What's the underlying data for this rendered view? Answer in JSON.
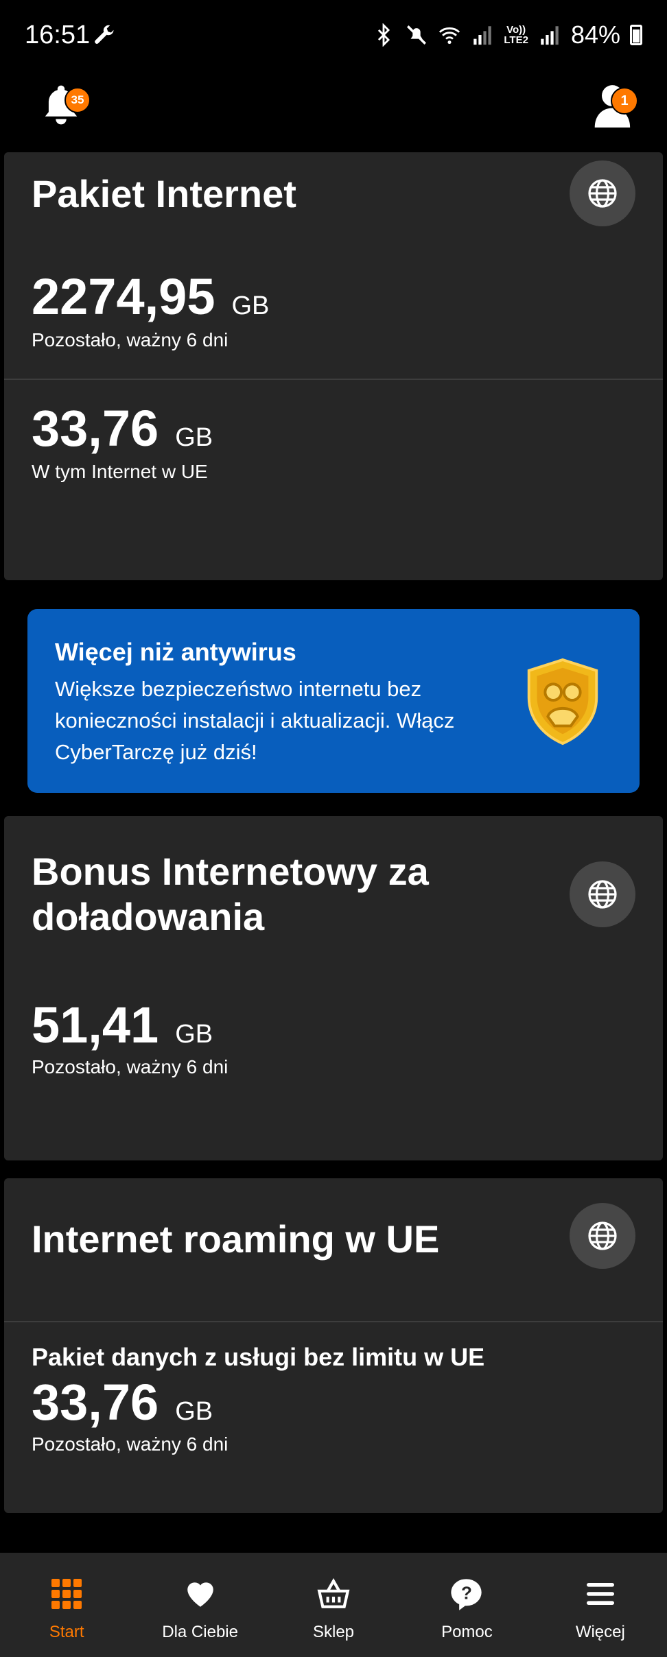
{
  "status_bar": {
    "time": "16:51",
    "battery": "84%",
    "volte_top": "Vo))",
    "volte_bottom": "LTE2"
  },
  "top_bar": {
    "notifications_count": "35",
    "profile_count": "1"
  },
  "cards": {
    "pakiet": {
      "title": "Pakiet Internet",
      "remaining_value": "2274,95",
      "remaining_unit": "GB",
      "remaining_caption": "Pozostało, ważny 6 dni",
      "eu_value": "33,76",
      "eu_unit": "GB",
      "eu_caption": "W tym Internet w UE"
    },
    "bonus": {
      "title_line1": "Bonus Internetowy za",
      "title_line2": "doładowania",
      "value": "51,41",
      "unit": "GB",
      "caption": "Pozostało, ważny 6 dni"
    },
    "roaming": {
      "title": "Internet roaming w UE",
      "subtitle": "Pakiet danych z usługi bez limitu w UE",
      "value": "33,76",
      "unit": "GB",
      "caption": "Pozostało, ważny 6 dni"
    }
  },
  "promo": {
    "title": "Więcej niż antywirus",
    "text": "Większe bezpieczeństwo internetu bez konieczności instalacji i aktualizacji. Włącz CyberTarczę już dziś!"
  },
  "bottom_nav": {
    "items": [
      {
        "label": "Start",
        "icon": "grid-icon",
        "active": true
      },
      {
        "label": "Dla Ciebie",
        "icon": "heart-icon",
        "active": false
      },
      {
        "label": "Sklep",
        "icon": "basket-icon",
        "active": false
      },
      {
        "label": "Pomoc",
        "icon": "help-bubble-icon",
        "active": false
      },
      {
        "label": "Więcej",
        "icon": "menu-icon",
        "active": false
      }
    ]
  },
  "colors": {
    "accent": "#ff7900",
    "card_bg": "#262626",
    "promo_bg": "#085ebd",
    "background": "#000000"
  }
}
